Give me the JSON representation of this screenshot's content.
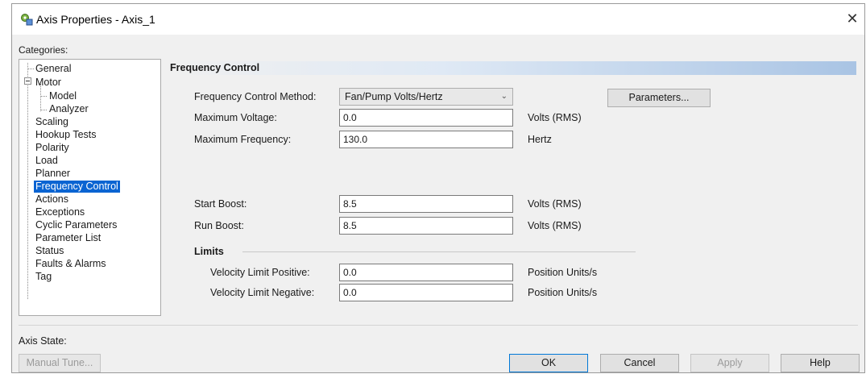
{
  "window": {
    "title": "Axis Properties - Axis_1",
    "close_symbol": "✕",
    "icon": "axis-properties-icon"
  },
  "categories": {
    "label": "Categories:",
    "items": [
      {
        "label": "General",
        "level": 0
      },
      {
        "label": "Motor",
        "level": 0,
        "expanded": true
      },
      {
        "label": "Model",
        "level": 1
      },
      {
        "label": "Analyzer",
        "level": 1
      },
      {
        "label": "Scaling",
        "level": 0
      },
      {
        "label": "Hookup Tests",
        "level": 0
      },
      {
        "label": "Polarity",
        "level": 0
      },
      {
        "label": "Load",
        "level": 0
      },
      {
        "label": "Planner",
        "level": 0
      },
      {
        "label": "Frequency Control",
        "level": 0,
        "selected": true
      },
      {
        "label": "Actions",
        "level": 0
      },
      {
        "label": "Exceptions",
        "level": 0
      },
      {
        "label": "Cyclic Parameters",
        "level": 0
      },
      {
        "label": "Parameter List",
        "level": 0
      },
      {
        "label": "Status",
        "level": 0
      },
      {
        "label": "Faults & Alarms",
        "level": 0
      },
      {
        "label": "Tag",
        "level": 0
      }
    ]
  },
  "panel": {
    "title": "Frequency Control",
    "method": {
      "label": "Frequency Control Method:",
      "value": "Fan/Pump Volts/Hertz"
    },
    "parameters_button": "Parameters...",
    "max_voltage": {
      "label": "Maximum Voltage:",
      "value": "0.0",
      "unit": "Volts (RMS)"
    },
    "max_frequency": {
      "label": "Maximum Frequency:",
      "value": "130.0",
      "unit": "Hertz"
    },
    "start_boost": {
      "label": "Start Boost:",
      "value": "8.5",
      "unit": "Volts (RMS)"
    },
    "run_boost": {
      "label": "Run Boost:",
      "value": "8.5",
      "unit": "Volts (RMS)"
    },
    "limits": {
      "title": "Limits",
      "vel_pos": {
        "label": "Velocity Limit Positive:",
        "value": "0.0",
        "unit": "Position Units/s"
      },
      "vel_neg": {
        "label": "Velocity Limit Negative:",
        "value": "0.0",
        "unit": "Position Units/s"
      }
    }
  },
  "footer": {
    "axis_state_label": "Axis State:",
    "manual_tune": "Manual Tune...",
    "ok": "OK",
    "cancel": "Cancel",
    "apply": "Apply",
    "help": "Help"
  },
  "colors": {
    "selection": "#0a64d2",
    "header_gradient_end": "#a9c4e4"
  }
}
